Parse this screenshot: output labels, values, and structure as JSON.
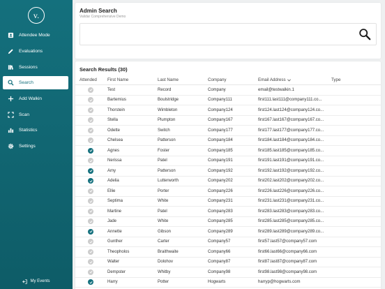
{
  "colors": {
    "sidebar": "#14707d",
    "checked": "#14707d",
    "unchecked": "#cccccc"
  },
  "sidebar": {
    "logo": "v.",
    "items": [
      {
        "label": "Attendee Mode",
        "icon": "badge-icon",
        "active": false
      },
      {
        "label": "Evaluations",
        "icon": "pencil-icon",
        "active": false
      },
      {
        "label": "Sessions",
        "icon": "books-icon",
        "active": false
      },
      {
        "label": "Search",
        "icon": "search-icon",
        "active": true
      },
      {
        "label": "Add Walkin",
        "icon": "plus-icon",
        "active": false
      },
      {
        "label": "Scan",
        "icon": "scan-icon",
        "active": false
      },
      {
        "label": "Statistics",
        "icon": "bar-chart-icon",
        "active": false
      },
      {
        "label": "Settings",
        "icon": "gear-icon",
        "active": false
      }
    ],
    "my_events": "My Events"
  },
  "search": {
    "title": "Admin Search",
    "subtitle": "Validar Comprehensive Demo",
    "value": "",
    "placeholder": ""
  },
  "results": {
    "title": "Search Results (30)",
    "columns": {
      "attended": "Attended",
      "first": "First Name",
      "last": "Last Name",
      "company": "Company",
      "email": "Email Address",
      "type": "Type"
    },
    "rows": [
      {
        "attended": false,
        "first": "Test",
        "last": "Record",
        "company": "Company",
        "email": "email@testwalkin.1"
      },
      {
        "attended": false,
        "first": "Bartemius",
        "last": "Boulstridge",
        "company": "Company111",
        "email": "first111.last111@company111.co..."
      },
      {
        "attended": false,
        "first": "Thorstein",
        "last": "Wimbleton",
        "company": "Company124",
        "email": "first124.last124@company124.co..."
      },
      {
        "attended": false,
        "first": "Stella",
        "last": "Plumpton",
        "company": "Company167",
        "email": "first167.last167@company167.co..."
      },
      {
        "attended": false,
        "first": "Odette",
        "last": "Switch",
        "company": "Company177",
        "email": "first177.last177@company177.co..."
      },
      {
        "attended": false,
        "first": "Chelsea",
        "last": "Patterson",
        "company": "Company184",
        "email": "first184.last184@company184.co..."
      },
      {
        "attended": true,
        "first": "Agnes",
        "last": "Foster",
        "company": "Company185",
        "email": "first185.last185@company185.co..."
      },
      {
        "attended": false,
        "first": "Nerissa",
        "last": "Patel",
        "company": "Company191",
        "email": "first191.last191@company191.co..."
      },
      {
        "attended": true,
        "first": "Amy",
        "last": "Patterson",
        "company": "Company192",
        "email": "first192.last192@company192.co..."
      },
      {
        "attended": true,
        "first": "Adelia",
        "last": "Lutterworth",
        "company": "Company202",
        "email": "first202.last202@company202.co..."
      },
      {
        "attended": false,
        "first": "Ellie",
        "last": "Porter",
        "company": "Company226",
        "email": "first226.last226@company226.co..."
      },
      {
        "attended": false,
        "first": "Septima",
        "last": "White",
        "company": "Company231",
        "email": "first231.last231@company231.co..."
      },
      {
        "attended": false,
        "first": "Martine",
        "last": "Patel",
        "company": "Company283",
        "email": "first283.last283@company283.co..."
      },
      {
        "attended": false,
        "first": "Jade",
        "last": "White",
        "company": "Company285",
        "email": "first285.last285@company285.co..."
      },
      {
        "attended": true,
        "first": "Annette",
        "last": "Gibson",
        "company": "Company289",
        "email": "first289.last289@company289.co..."
      },
      {
        "attended": false,
        "first": "Gunther",
        "last": "Carter",
        "company": "Company57",
        "email": "first57.last57@company57.com"
      },
      {
        "attended": false,
        "first": "Theopholos",
        "last": "Braithwaite",
        "company": "Company66",
        "email": "first66.last66@company66.com"
      },
      {
        "attended": false,
        "first": "Walter",
        "last": "Dolohov",
        "company": "Company87",
        "email": "first87.last87@company87.com"
      },
      {
        "attended": false,
        "first": "Dempster",
        "last": "Whitby",
        "company": "Company98",
        "email": "first98.last98@company98.com"
      },
      {
        "attended": true,
        "first": "Harry",
        "last": "Potter",
        "company": "Hogwarts",
        "email": "harryp@hogwarts.com"
      }
    ]
  }
}
